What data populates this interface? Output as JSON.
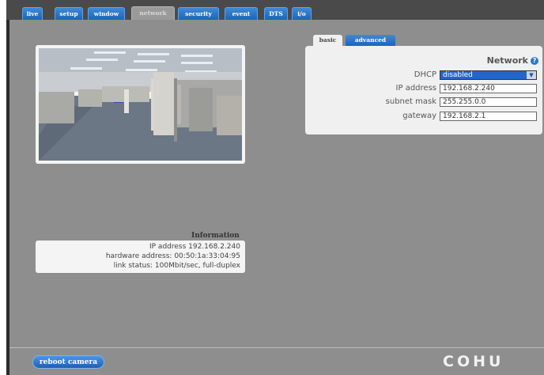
{
  "tabs": [
    {
      "label": "live"
    },
    {
      "label": "setup"
    },
    {
      "label": "window"
    },
    {
      "label": "network"
    },
    {
      "label": "security"
    },
    {
      "label": "event"
    },
    {
      "label": "DTS"
    },
    {
      "label": "i/o"
    }
  ],
  "active_tab": "network",
  "subtabs": {
    "basic": "basic",
    "advanced": "advanced"
  },
  "network": {
    "title": "Network",
    "help_icon": "?",
    "dhcp_label": "DHCP",
    "dhcp_value": "disabled",
    "ip_label": "IP address",
    "ip_value": "192.168.2.240",
    "subnet_label": "subnet mask",
    "subnet_value": "255.255.0.0",
    "gateway_label": "gateway",
    "gateway_value": "192.168.2.1"
  },
  "information": {
    "title": "Information",
    "line1": "IP address 192.168.2.240",
    "line2": "hardware address: 00:50:1a:33:04:95",
    "line3": "link status: 100Mbit/sec, full-duplex"
  },
  "footer": {
    "reboot_label": "reboot camera",
    "logo": "COHU"
  },
  "colors": {
    "tab_blue": "#1e63b8",
    "panel_grey": "#8e8e8e",
    "select_blue": "#2266cc"
  }
}
